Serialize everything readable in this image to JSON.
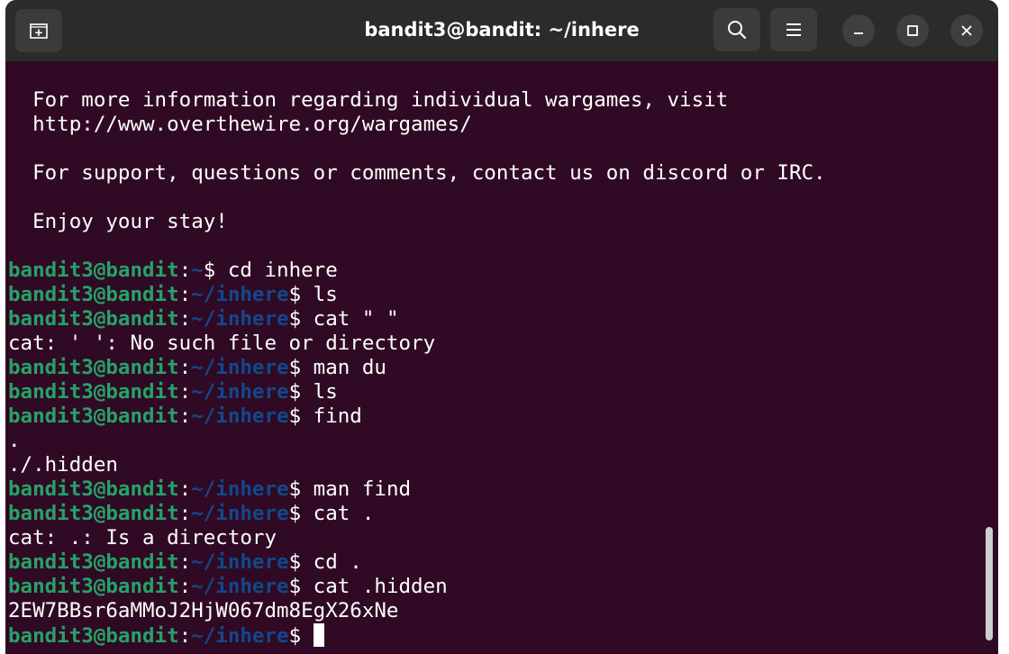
{
  "window": {
    "title": "bandit3@bandit: ~/inhere",
    "buttons": {
      "new_tab_icon": "new-tab-icon",
      "search_icon": "search-icon",
      "menu_icon": "hamburger-menu-icon",
      "minimize_icon": "minimize-icon",
      "maximize_icon": "maximize-icon",
      "close_icon": "close-icon"
    }
  },
  "colors": {
    "background": "#300a24",
    "prompt_user": "#26a269",
    "prompt_path": "#12488b",
    "text": "#ffffff"
  },
  "terminal": {
    "lines": [
      {
        "type": "blank"
      },
      {
        "type": "output",
        "text": "  For more information regarding individual wargames, visit"
      },
      {
        "type": "output",
        "text": "  http://www.overthewire.org/wargames/"
      },
      {
        "type": "blank"
      },
      {
        "type": "output",
        "text": "  For support, questions or comments, contact us on discord or IRC."
      },
      {
        "type": "blank"
      },
      {
        "type": "output",
        "text": "  Enjoy your stay!"
      },
      {
        "type": "blank"
      },
      {
        "type": "prompt",
        "user": "bandit3@bandit",
        "sep": ":",
        "path": "~",
        "dollar": "$ ",
        "cmd": "cd inhere"
      },
      {
        "type": "prompt",
        "user": "bandit3@bandit",
        "sep": ":",
        "path": "~/inhere",
        "dollar": "$ ",
        "cmd": "ls"
      },
      {
        "type": "prompt",
        "user": "bandit3@bandit",
        "sep": ":",
        "path": "~/inhere",
        "dollar": "$ ",
        "cmd": "cat \" \""
      },
      {
        "type": "output",
        "text": "cat: ' ': No such file or directory"
      },
      {
        "type": "prompt",
        "user": "bandit3@bandit",
        "sep": ":",
        "path": "~/inhere",
        "dollar": "$ ",
        "cmd": "man du"
      },
      {
        "type": "prompt",
        "user": "bandit3@bandit",
        "sep": ":",
        "path": "~/inhere",
        "dollar": "$ ",
        "cmd": "ls"
      },
      {
        "type": "prompt",
        "user": "bandit3@bandit",
        "sep": ":",
        "path": "~/inhere",
        "dollar": "$ ",
        "cmd": "find"
      },
      {
        "type": "output",
        "text": "."
      },
      {
        "type": "output",
        "text": "./.hidden"
      },
      {
        "type": "prompt",
        "user": "bandit3@bandit",
        "sep": ":",
        "path": "~/inhere",
        "dollar": "$ ",
        "cmd": "man find"
      },
      {
        "type": "prompt",
        "user": "bandit3@bandit",
        "sep": ":",
        "path": "~/inhere",
        "dollar": "$ ",
        "cmd": "cat ."
      },
      {
        "type": "output",
        "text": "cat: .: Is a directory"
      },
      {
        "type": "prompt",
        "user": "bandit3@bandit",
        "sep": ":",
        "path": "~/inhere",
        "dollar": "$ ",
        "cmd": "cd ."
      },
      {
        "type": "prompt",
        "user": "bandit3@bandit",
        "sep": ":",
        "path": "~/inhere",
        "dollar": "$ ",
        "cmd": "cat .hidden"
      },
      {
        "type": "output",
        "text": "2EW7BBsr6aMMoJ2HjW067dm8EgX26xNe"
      },
      {
        "type": "prompt",
        "user": "bandit3@bandit",
        "sep": ":",
        "path": "~/inhere",
        "dollar": "$ ",
        "cmd": "",
        "cursor": true
      }
    ]
  }
}
